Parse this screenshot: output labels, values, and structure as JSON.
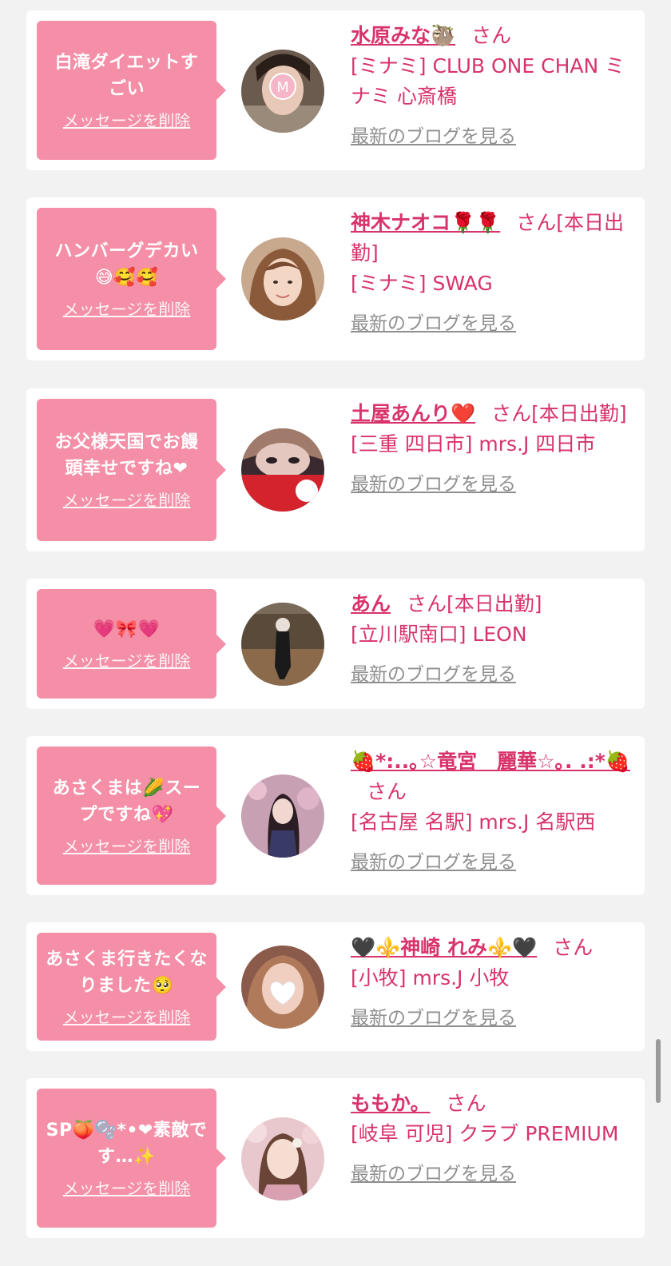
{
  "items": [
    {
      "message": "白滝ダイエットすごい",
      "delete_label": "メッセージを削除",
      "name": "水原みな🦥",
      "san": "さん",
      "shop": "[ミナミ] CLUB ONE CHAN ミナミ 心斎橋",
      "blog_label": "最新のブログを見る"
    },
    {
      "message": "ハンバーグデカい😅🥰🥰",
      "delete_label": "メッセージを削除",
      "name": "神木ナオコ🌹🌹",
      "san": "さん[本日出勤]",
      "shop": "[ミナミ] SWAG",
      "blog_label": "最新のブログを見る"
    },
    {
      "message": "お父様天国でお饅頭幸せですね❤",
      "delete_label": "メッセージを削除",
      "name": "土屋あんり❤️",
      "san": "さん[本日出勤]",
      "shop": "[三重 四日市] mrs.J 四日市",
      "blog_label": "最新のブログを見る"
    },
    {
      "message": "💗🎀💗",
      "delete_label": "メッセージを削除",
      "name": "あん",
      "san": "さん[本日出勤]",
      "shop": "[立川駅南口] LEON",
      "blog_label": "最新のブログを見る"
    },
    {
      "message": "あさくまは🌽スープですね💖",
      "delete_label": "メッセージを削除",
      "name": "🍓*:..｡☆竜宮　麗華☆｡. .:*🍓",
      "san": "さん",
      "shop": "[名古屋 名駅] mrs.J 名駅西",
      "blog_label": "最新のブログを見る"
    },
    {
      "message": "あさくま行きたくなりました🥺",
      "delete_label": "メッセージを削除",
      "name": "🖤⚜️神崎 れみ⚜️🖤",
      "san": "さん",
      "shop": "[小牧] mrs.J 小牧",
      "blog_label": "最新のブログを見る"
    },
    {
      "message": "SP🍑🫧*•❤素敵です…✨",
      "delete_label": "メッセージを削除",
      "name": "ももか。",
      "san": "さん",
      "shop": "[岐阜 可児] クラブ PREMIUM",
      "blog_label": "最新のブログを見る"
    }
  ],
  "colors": {
    "page_bg": "#f2f2f2",
    "card_bg": "#ffffff",
    "bubble_bg": "#f48fa7",
    "name_color": "#d8336a",
    "blog_link": "#8f8f8f"
  }
}
